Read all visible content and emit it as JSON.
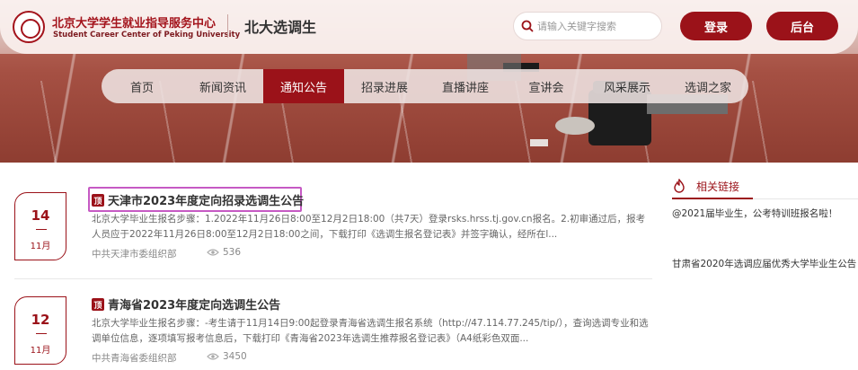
{
  "header": {
    "org_name_cn": "北京大学学生就业指导服务中心",
    "org_name_en": "Student Career Center of Peking University",
    "site_title": "北大选调生",
    "search_placeholder": "请输入关键字搜索",
    "login_label": "登录",
    "admin_label": "后台"
  },
  "nav": {
    "items": [
      {
        "label": "首页",
        "active": false
      },
      {
        "label": "新闻资讯",
        "active": false
      },
      {
        "label": "通知公告",
        "active": true
      },
      {
        "label": "招录进展",
        "active": false
      },
      {
        "label": "直播讲座",
        "active": false
      },
      {
        "label": "宣讲会",
        "active": false
      },
      {
        "label": "风采展示",
        "active": false
      },
      {
        "label": "选调之家",
        "active": false
      }
    ]
  },
  "notices": [
    {
      "day": "14",
      "month": "11月",
      "badge": "顶",
      "title": "天津市2023年度定向招录选调生公告",
      "summary": "北京大学毕业生报名步骤：1.2022年11月26日8:00至12月2日18:00（共7天）登录rsks.hrss.tj.gov.cn报名。2.初审通过后，报考人员应于2022年11月26日8:00至12月2日18:00之间，下载打印《选调生报名登记表》并签字确认，经所在l...",
      "source": "中共天津市委组织部",
      "views": "536"
    },
    {
      "day": "12",
      "month": "11月",
      "badge": "顶",
      "title": "青海省2023年度定向选调生公告",
      "summary": "北京大学毕业生报名步骤：-考生请于11月14日9:00起登录青海省选调生报名系统（http://47.114.77.245/tip/），查询选调专业和选调单位信息，逐项填写报考信息后，下载打印《青海省2023年选调生推荐报名登记表》（A4纸彩色双面...",
      "source": "中共青海省委组织部",
      "views": "3450"
    }
  ],
  "sidebar": {
    "title": "相关链接",
    "links": [
      "@2021届毕业生，公考特训班报名啦！",
      "甘肃省2020年选调应届优秀大学毕业生公告"
    ]
  },
  "colors": {
    "brand": "#9b1219",
    "highlight_frame": "#c65ac4"
  }
}
